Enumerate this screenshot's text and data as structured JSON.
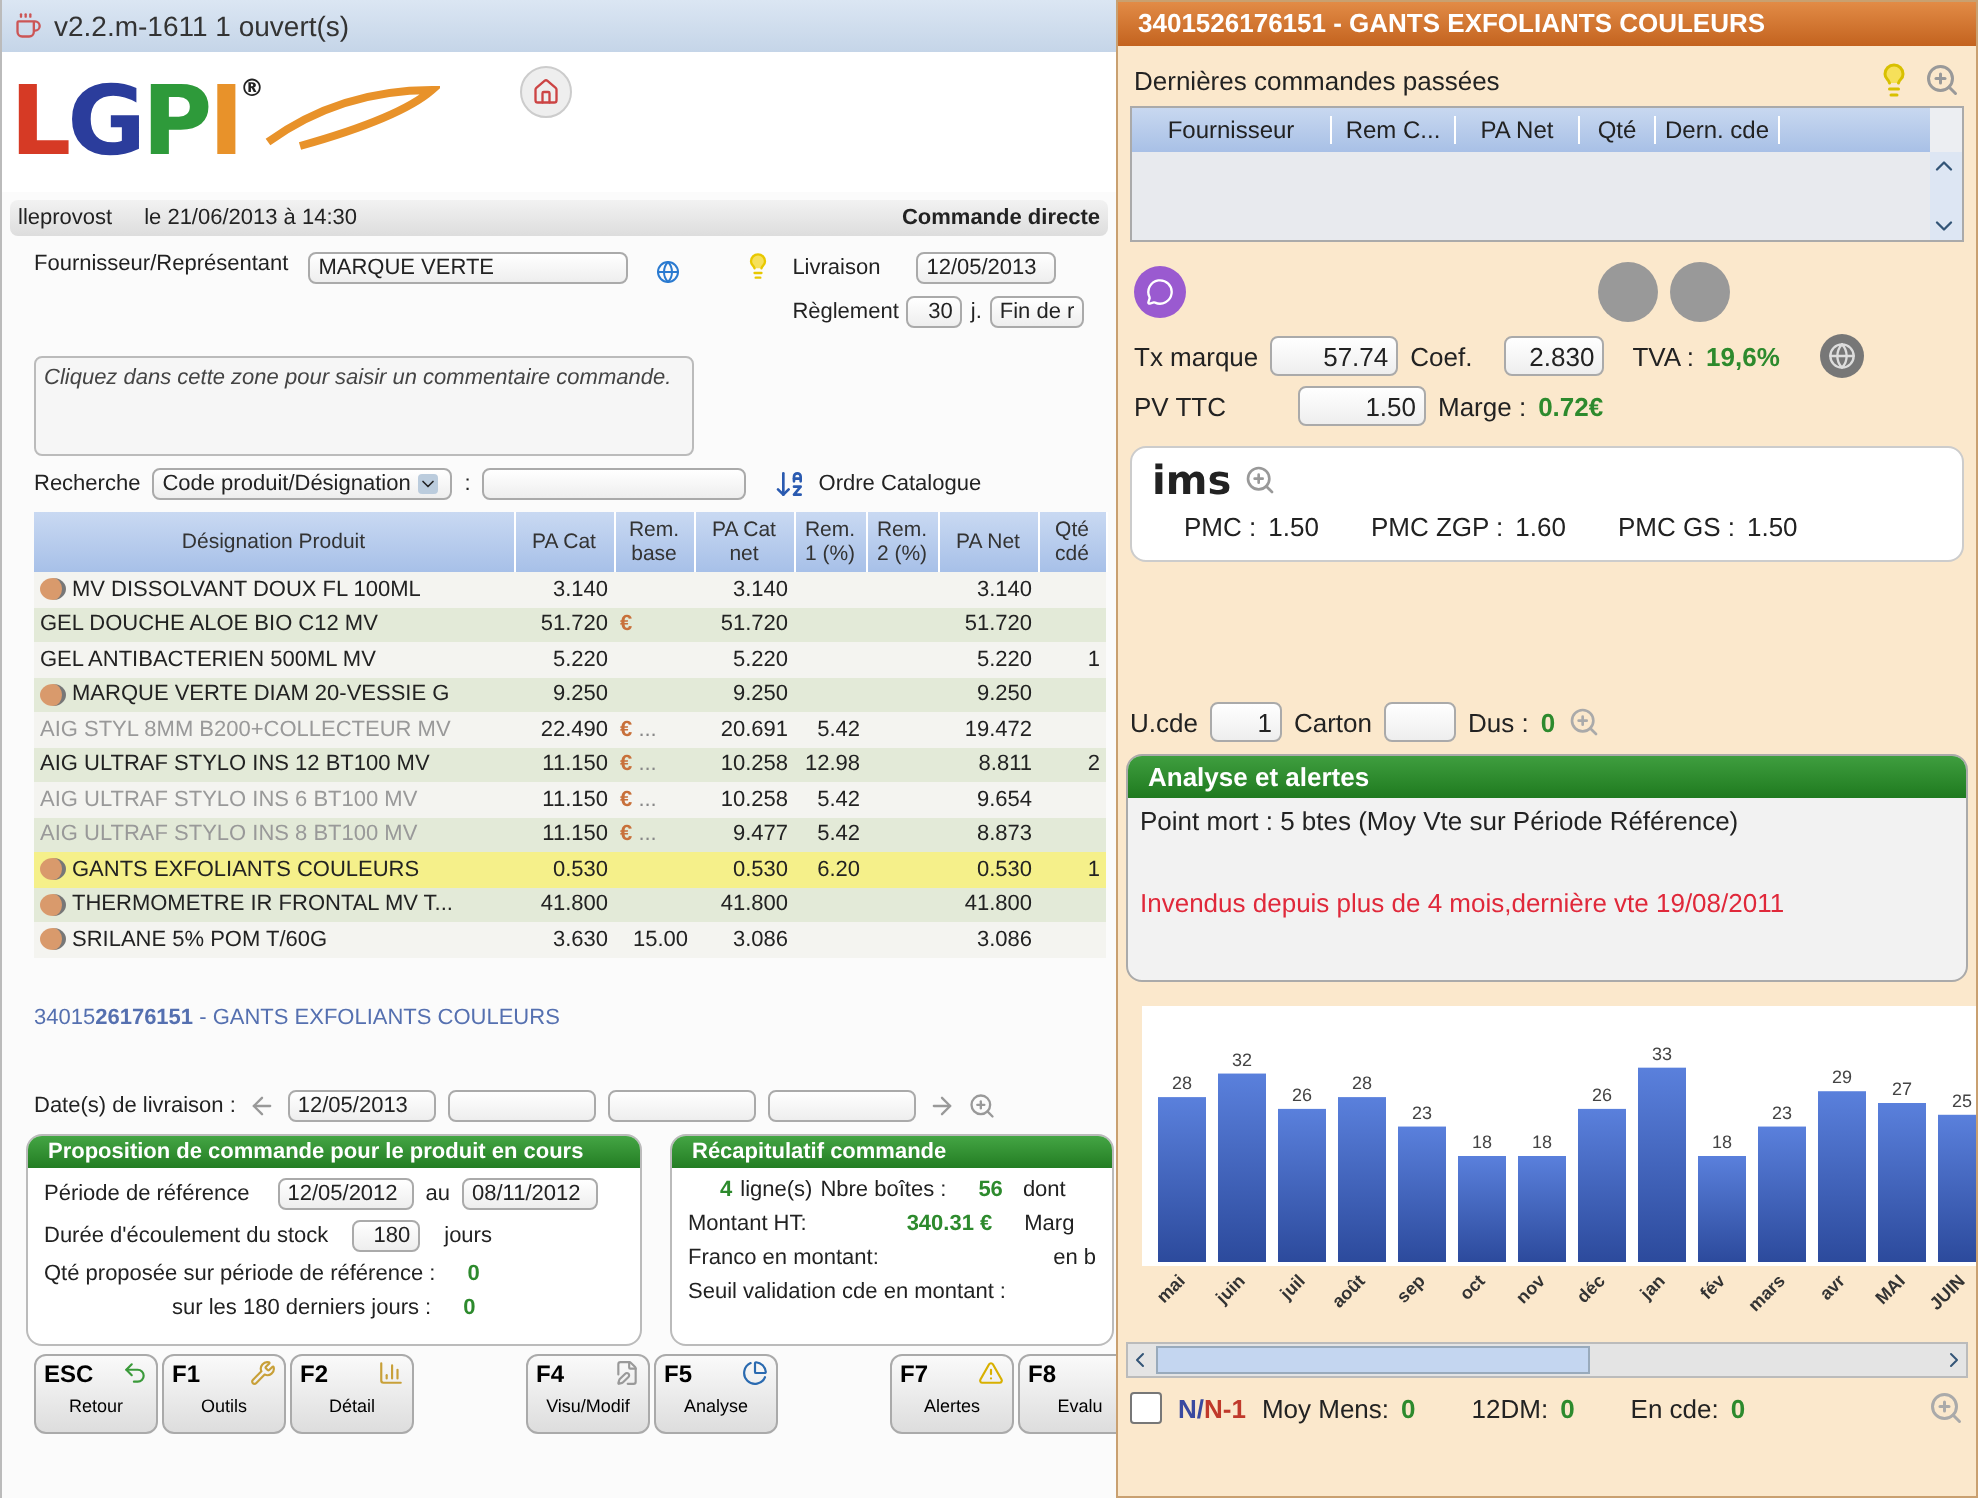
{
  "window": {
    "title": "v2.2.m-1611 1 ouvert(s)"
  },
  "logo": {
    "letters": [
      {
        "text": "L",
        "color": "#d63a25"
      },
      {
        "text": "G",
        "color": "#2b3d9c"
      },
      {
        "text": "P",
        "color": "#2e9a3a"
      },
      {
        "text": "I",
        "color": "#e8922a"
      }
    ],
    "mark": "®"
  },
  "info_bar": {
    "user": "lleprovost",
    "date": "le 21/06/2013 à 14:30",
    "mode": "Commande directe"
  },
  "supplier": {
    "label": "Fournisseur/Représentant",
    "value": "MARQUE VERTE"
  },
  "delivery": {
    "label": "Livraison",
    "value": "12/05/2013"
  },
  "payment": {
    "label": "Règlement",
    "days": "30",
    "unit": "j.",
    "term": "Fin de r"
  },
  "comment": {
    "placeholder": "Cliquez dans cette zone pour saisir un commentaire commande."
  },
  "search": {
    "label": "Recherche",
    "mode": "Code produit/Désignation",
    "separator": ":",
    "order": "Ordre Catalogue"
  },
  "table": {
    "columns": [
      "Désignation Produit",
      "PA Cat",
      "Rem. base",
      "PA Cat net",
      "Rem. 1 (%)",
      "Rem. 2 (%)",
      "PA Net",
      "Qté cdé"
    ],
    "rows": [
      {
        "hand": true,
        "disabled": false,
        "selected": false,
        "name": "MV DISSOLVANT DOUX FL 100ML",
        "pa_cat": "3.140",
        "rem_base": "",
        "more": "",
        "pa_cat_net": "3.140",
        "rem1": "",
        "rem2": "",
        "pa_net": "3.140",
        "qty": ""
      },
      {
        "hand": false,
        "euro_sign": "€",
        "disabled": false,
        "selected": false,
        "name": "GEL DOUCHE ALOE BIO C12 MV",
        "pa_cat": "51.720",
        "rem_base": "",
        "more": "",
        "pa_cat_net": "51.720",
        "rem1": "",
        "rem2": "",
        "pa_net": "51.720",
        "qty": ""
      },
      {
        "hand": false,
        "disabled": false,
        "selected": false,
        "name": "GEL ANTIBACTERIEN 500ML MV",
        "pa_cat": "5.220",
        "rem_base": "",
        "more": "",
        "pa_cat_net": "5.220",
        "rem1": "",
        "rem2": "",
        "pa_net": "5.220",
        "qty": "1"
      },
      {
        "hand": true,
        "disabled": false,
        "selected": false,
        "name": "MARQUE VERTE DIAM 20-VESSIE G",
        "pa_cat": "9.250",
        "rem_base": "",
        "more": "",
        "pa_cat_net": "9.250",
        "rem1": "",
        "rem2": "",
        "pa_net": "9.250",
        "qty": ""
      },
      {
        "hand": false,
        "euro_sign": "€",
        "disabled": true,
        "selected": false,
        "name": "AIG STYL 8MM B200+COLLECTEUR MV",
        "pa_cat": "22.490",
        "rem_base": "",
        "more": "...",
        "pa_cat_net": "20.691",
        "rem1": "5.42",
        "rem2": "",
        "pa_net": "19.472",
        "qty": ""
      },
      {
        "hand": false,
        "euro_sign": "€",
        "disabled": false,
        "selected": false,
        "name": "AIG ULTRAF STYLO INS 12 BT100 MV",
        "pa_cat": "11.150",
        "rem_base": "",
        "more": "...",
        "pa_cat_net": "10.258",
        "rem1": "12.98",
        "rem2": "",
        "pa_net": "8.811",
        "qty": "2"
      },
      {
        "hand": false,
        "euro_sign": "€",
        "disabled": true,
        "selected": false,
        "name": "AIG ULTRAF STYLO INS 6 BT100 MV",
        "pa_cat": "11.150",
        "rem_base": "",
        "more": "...",
        "pa_cat_net": "10.258",
        "rem1": "5.42",
        "rem2": "",
        "pa_net": "9.654",
        "qty": ""
      },
      {
        "hand": false,
        "euro_sign": "€",
        "disabled": true,
        "selected": false,
        "name": "AIG ULTRAF STYLO INS 8 BT100 MV",
        "pa_cat": "11.150",
        "rem_base": "",
        "more": "...",
        "pa_cat_net": "9.477",
        "rem1": "5.42",
        "rem2": "",
        "pa_net": "8.873",
        "qty": ""
      },
      {
        "hand": true,
        "disabled": false,
        "selected": true,
        "name": "GANTS EXFOLIANTS COULEURS",
        "pa_cat": "0.530",
        "rem_base": "",
        "more": "",
        "pa_cat_net": "0.530",
        "rem1": "6.20",
        "rem2": "",
        "pa_net": "0.530",
        "qty": "1"
      },
      {
        "hand": true,
        "disabled": false,
        "selected": false,
        "name": "THERMOMETRE IR FRONTAL MV T...",
        "pa_cat": "41.800",
        "rem_base": "",
        "more": "",
        "pa_cat_net": "41.800",
        "rem1": "",
        "rem2": "",
        "pa_net": "41.800",
        "qty": ""
      },
      {
        "hand": true,
        "disabled": false,
        "selected": false,
        "name": "SRILANE 5% POM T/60G",
        "pa_cat": "3.630",
        "rem_base": "15.00",
        "more": "",
        "pa_cat_net": "3.086",
        "rem1": "",
        "rem2": "",
        "pa_net": "3.086",
        "qty": ""
      }
    ]
  },
  "product_line": "34015**26176151** - GANTS EXFOLIANTS COULEURS",
  "delivery_dates": {
    "label": "Date(s) de livraison :",
    "dates": [
      "12/05/2013"
    ]
  },
  "proposal": {
    "title": "Proposition de commande pour le produit en cours",
    "period_label": "Période de référence",
    "from": "12/05/2012",
    "to_label": "au",
    "to": "08/11/2012",
    "duration_label": "Durée d'écoulement du stock",
    "duration": "180",
    "duration_unit": "jours",
    "qty_label": "Qté proposée sur période de référence :",
    "qty": "0",
    "last_label": "sur les 180 derniers jours :",
    "last": "0"
  },
  "summary": {
    "title": "Récapitulatif commande",
    "lines_count": "4",
    "lines_label": "ligne(s)",
    "boxes_label": "Nbre boîtes :",
    "boxes": "56",
    "boxes_tail": "dont",
    "amount_label": "Montant HT:",
    "amount": "340.31 €",
    "amount_tail": "Marg",
    "franco_label": "Franco en montant:",
    "franco_tail": "en b",
    "threshold_label": "Seuil validation cde en montant :"
  },
  "function_keys": [
    [
      {
        "key": "ESC",
        "label": "Retour"
      },
      {
        "key": "F1",
        "label": "Outils"
      },
      {
        "key": "F2",
        "label": "Détail"
      }
    ],
    [
      {
        "key": "F4",
        "label": "Visu/Modif"
      },
      {
        "key": "F5",
        "label": "Analyse"
      }
    ],
    [
      {
        "key": "F7",
        "label": "Alertes"
      },
      {
        "key": "F8",
        "label": "Evalu"
      }
    ]
  ],
  "detail": {
    "title": "3401526176151 - GANTS EXFOLIANTS COULEURS",
    "orders_title": "Dernières commandes passées",
    "orders_columns": [
      "Fournisseur",
      "Rem C...",
      "PA Net",
      "Qté",
      "Dern. cde"
    ],
    "tx_label": "Tx marque",
    "tx": "57.74",
    "coef_label": "Coef.",
    "coef": "2.830",
    "tva_label": "TVA :",
    "tva": "19,6%",
    "pv_label": "PV TTC",
    "pv": "1.50",
    "margin_label": "Marge :",
    "margin": "0.72€",
    "ims": {
      "logo": "ims",
      "items": [
        {
          "label": "PMC :",
          "value": "1.50"
        },
        {
          "label": "PMC ZGP :",
          "value": "1.60"
        },
        {
          "label": "PMC GS :",
          "value": "1.50"
        }
      ]
    },
    "unit_label": "U.cde",
    "unit": "1",
    "carton_label": "Carton",
    "dus_label": "Dus :",
    "dus": "0",
    "alerts": {
      "title": "Analyse et alertes",
      "lines": [
        {
          "kind": "info",
          "text": "Point mort : 5 btes (Moy Vte sur Période Référence)"
        },
        {
          "kind": "warning",
          "text": "Invendus depuis plus de 4 mois,dernière vte 19/08/2011"
        }
      ]
    },
    "chart_data": {
      "type": "bar",
      "categories": [
        "mai",
        "juin",
        "juil",
        "août",
        "sep",
        "oct",
        "nov",
        "déc",
        "jan",
        "fév",
        "mars",
        "avr",
        "MAI",
        "JUIN"
      ],
      "values": [
        28,
        32,
        26,
        28,
        23,
        18,
        18,
        26,
        33,
        18,
        23,
        29,
        27,
        25
      ],
      "data_labels": true
    },
    "footer": {
      "checked": false,
      "label_parts": [
        {
          "text": "N/",
          "color": "#3a4aa0"
        },
        {
          "text": "N-1",
          "color": "#c0392b"
        }
      ],
      "stats": [
        {
          "label": "Moy Mens:",
          "value": "0"
        },
        {
          "label": "12DM:",
          "value": "0"
        },
        {
          "label": "En cde:",
          "value": "0"
        }
      ]
    }
  }
}
